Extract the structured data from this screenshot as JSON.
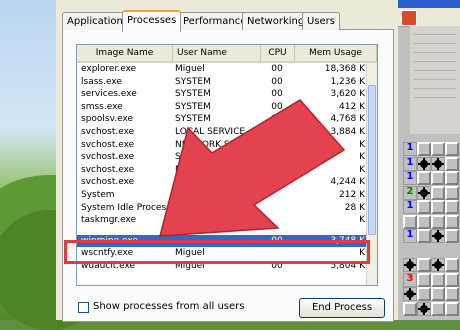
{
  "tabs": [
    "Applications",
    "Processes",
    "Performance",
    "Networking",
    "Users"
  ],
  "active_tab": "Processes",
  "columns": [
    "Image Name",
    "User Name",
    "CPU",
    "Mem Usage"
  ],
  "rows": [
    {
      "image": "explorer.exe",
      "user": "Miguel",
      "cpu": "00",
      "mem": "18,368 K"
    },
    {
      "image": "lsass.exe",
      "user": "SYSTEM",
      "cpu": "00",
      "mem": "1,236 K"
    },
    {
      "image": "services.exe",
      "user": "SYSTEM",
      "cpu": "00",
      "mem": "3,620 K"
    },
    {
      "image": "smss.exe",
      "user": "SYSTEM",
      "cpu": "00",
      "mem": "412 K"
    },
    {
      "image": "spoolsv.exe",
      "user": "SYSTEM",
      "cpu": "00",
      "mem": "4,768 K"
    },
    {
      "image": "svchost.exe",
      "user": "LOCAL SERVICE",
      "cpu": "00",
      "mem": "3,884 K"
    },
    {
      "image": "svchost.exe",
      "user": "NETWORK SER",
      "cpu": "",
      "mem": "K"
    },
    {
      "image": "svchost.exe",
      "user": "SYSTEM",
      "cpu": "",
      "mem": "K"
    },
    {
      "image": "svchost.exe",
      "user": "NETWORK",
      "cpu": "",
      "mem": "K"
    },
    {
      "image": "svchost.exe",
      "user": "LOCAL",
      "cpu": "",
      "mem": "4,244 K"
    },
    {
      "image": "System",
      "user": "SYST",
      "cpu": "",
      "mem": "212 K"
    },
    {
      "image": "System Idle Process",
      "user": "SYST",
      "cpu": "",
      "mem": "28 K"
    },
    {
      "image": "taskmgr.exe",
      "user": "",
      "cpu": "",
      "mem": "K"
    }
  ],
  "partial_row": {
    "image": "",
    "user": "",
    "cpu": "",
    "mem": ""
  },
  "selected_row": {
    "image": "winmine.exe",
    "user": "",
    "cpu": "00",
    "mem": "3,748 K"
  },
  "after_rows": [
    {
      "image": "wscntfy.exe",
      "user": "Miguel",
      "cpu": "",
      "mem": "K"
    },
    {
      "image": "wuauclt.exe",
      "user": "Miguel",
      "cpu": "00",
      "mem": "5,804 K"
    }
  ],
  "show_all_label": "Show processes from all users",
  "end_process_label": "End Process",
  "minesweeper_numbers": [
    "1",
    "1",
    "1",
    "2",
    "1",
    "1",
    "3"
  ],
  "colors": {
    "selection": "#316ac5",
    "highlight": "#e03a44",
    "arrow": "#e2434f"
  }
}
